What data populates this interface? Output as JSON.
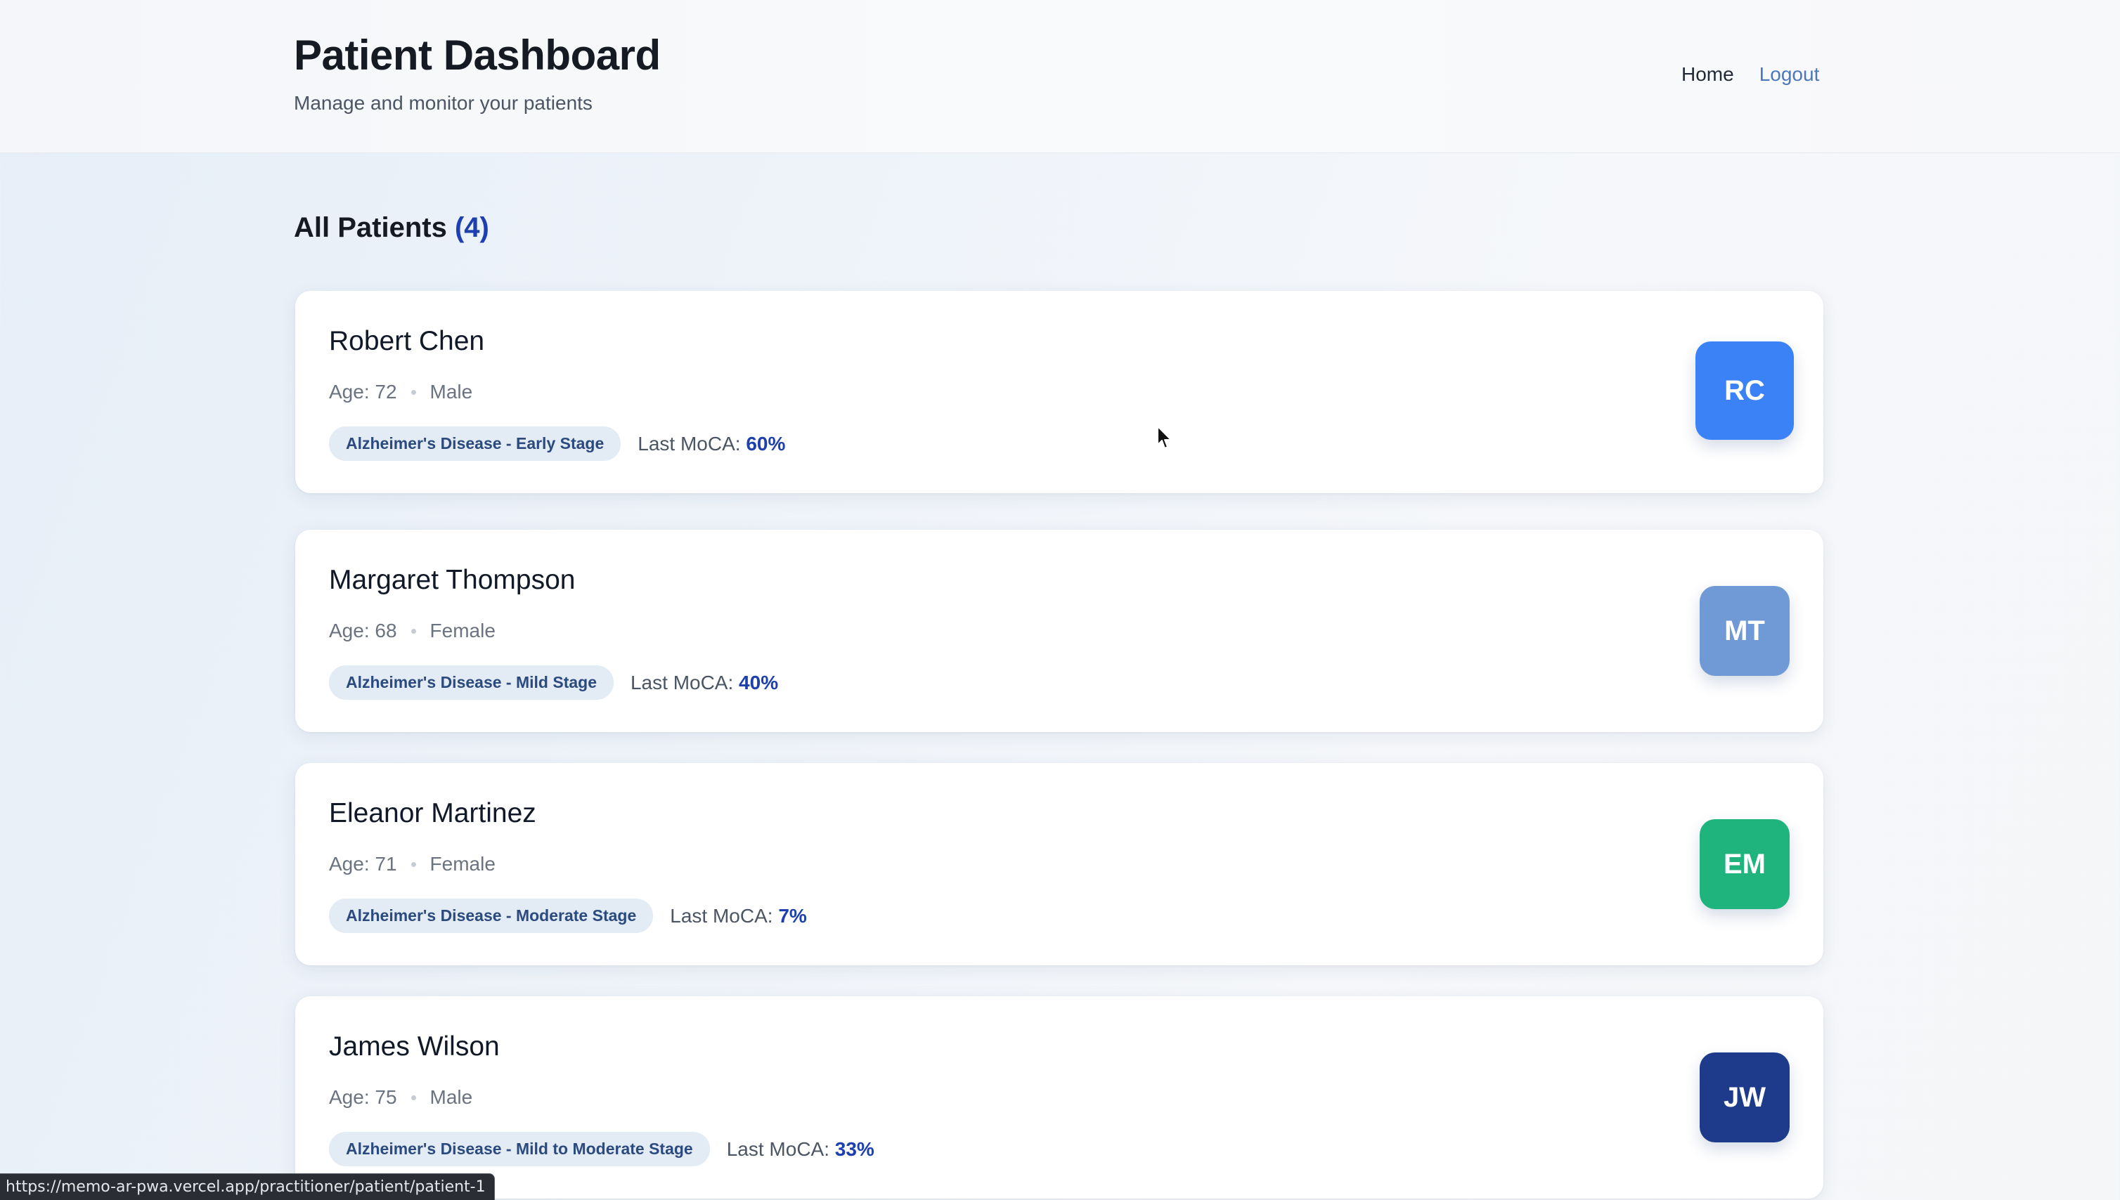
{
  "header": {
    "title": "Patient Dashboard",
    "subtitle": "Manage and monitor your patients",
    "nav": {
      "home": "Home",
      "logout": "Logout"
    }
  },
  "section": {
    "title": "All Patients",
    "count": "(4)"
  },
  "patients": [
    {
      "name": "Robert Chen",
      "age": "Age: 72",
      "gender": "Male",
      "diagnosis": "Alzheimer's Disease - Early Stage",
      "moca_label": "Last MoCA:",
      "moca_value": "60%",
      "initials": "RC",
      "avatar_color": "#3b82f6"
    },
    {
      "name": "Margaret Thompson",
      "age": "Age: 68",
      "gender": "Female",
      "diagnosis": "Alzheimer's Disease - Mild Stage",
      "moca_label": "Last MoCA:",
      "moca_value": "40%",
      "initials": "MT",
      "avatar_color": "#6f9ad6"
    },
    {
      "name": "Eleanor Martinez",
      "age": "Age: 71",
      "gender": "Female",
      "diagnosis": "Alzheimer's Disease - Moderate Stage",
      "moca_label": "Last MoCA:",
      "moca_value": "7%",
      "initials": "EM",
      "avatar_color": "#1fb47e"
    },
    {
      "name": "James Wilson",
      "age": "Age: 75",
      "gender": "Male",
      "diagnosis": "Alzheimer's Disease - Mild to Moderate Stage",
      "moca_label": "Last MoCA:",
      "moca_value": "33%",
      "initials": "JW",
      "avatar_color": "#1e3a8a"
    }
  ],
  "status_bar": {
    "url": "https://memo-ar-pwa.vercel.app/practitioner/patient/patient-1"
  },
  "icons": {
    "cursor": "mouse-pointer-icon"
  }
}
